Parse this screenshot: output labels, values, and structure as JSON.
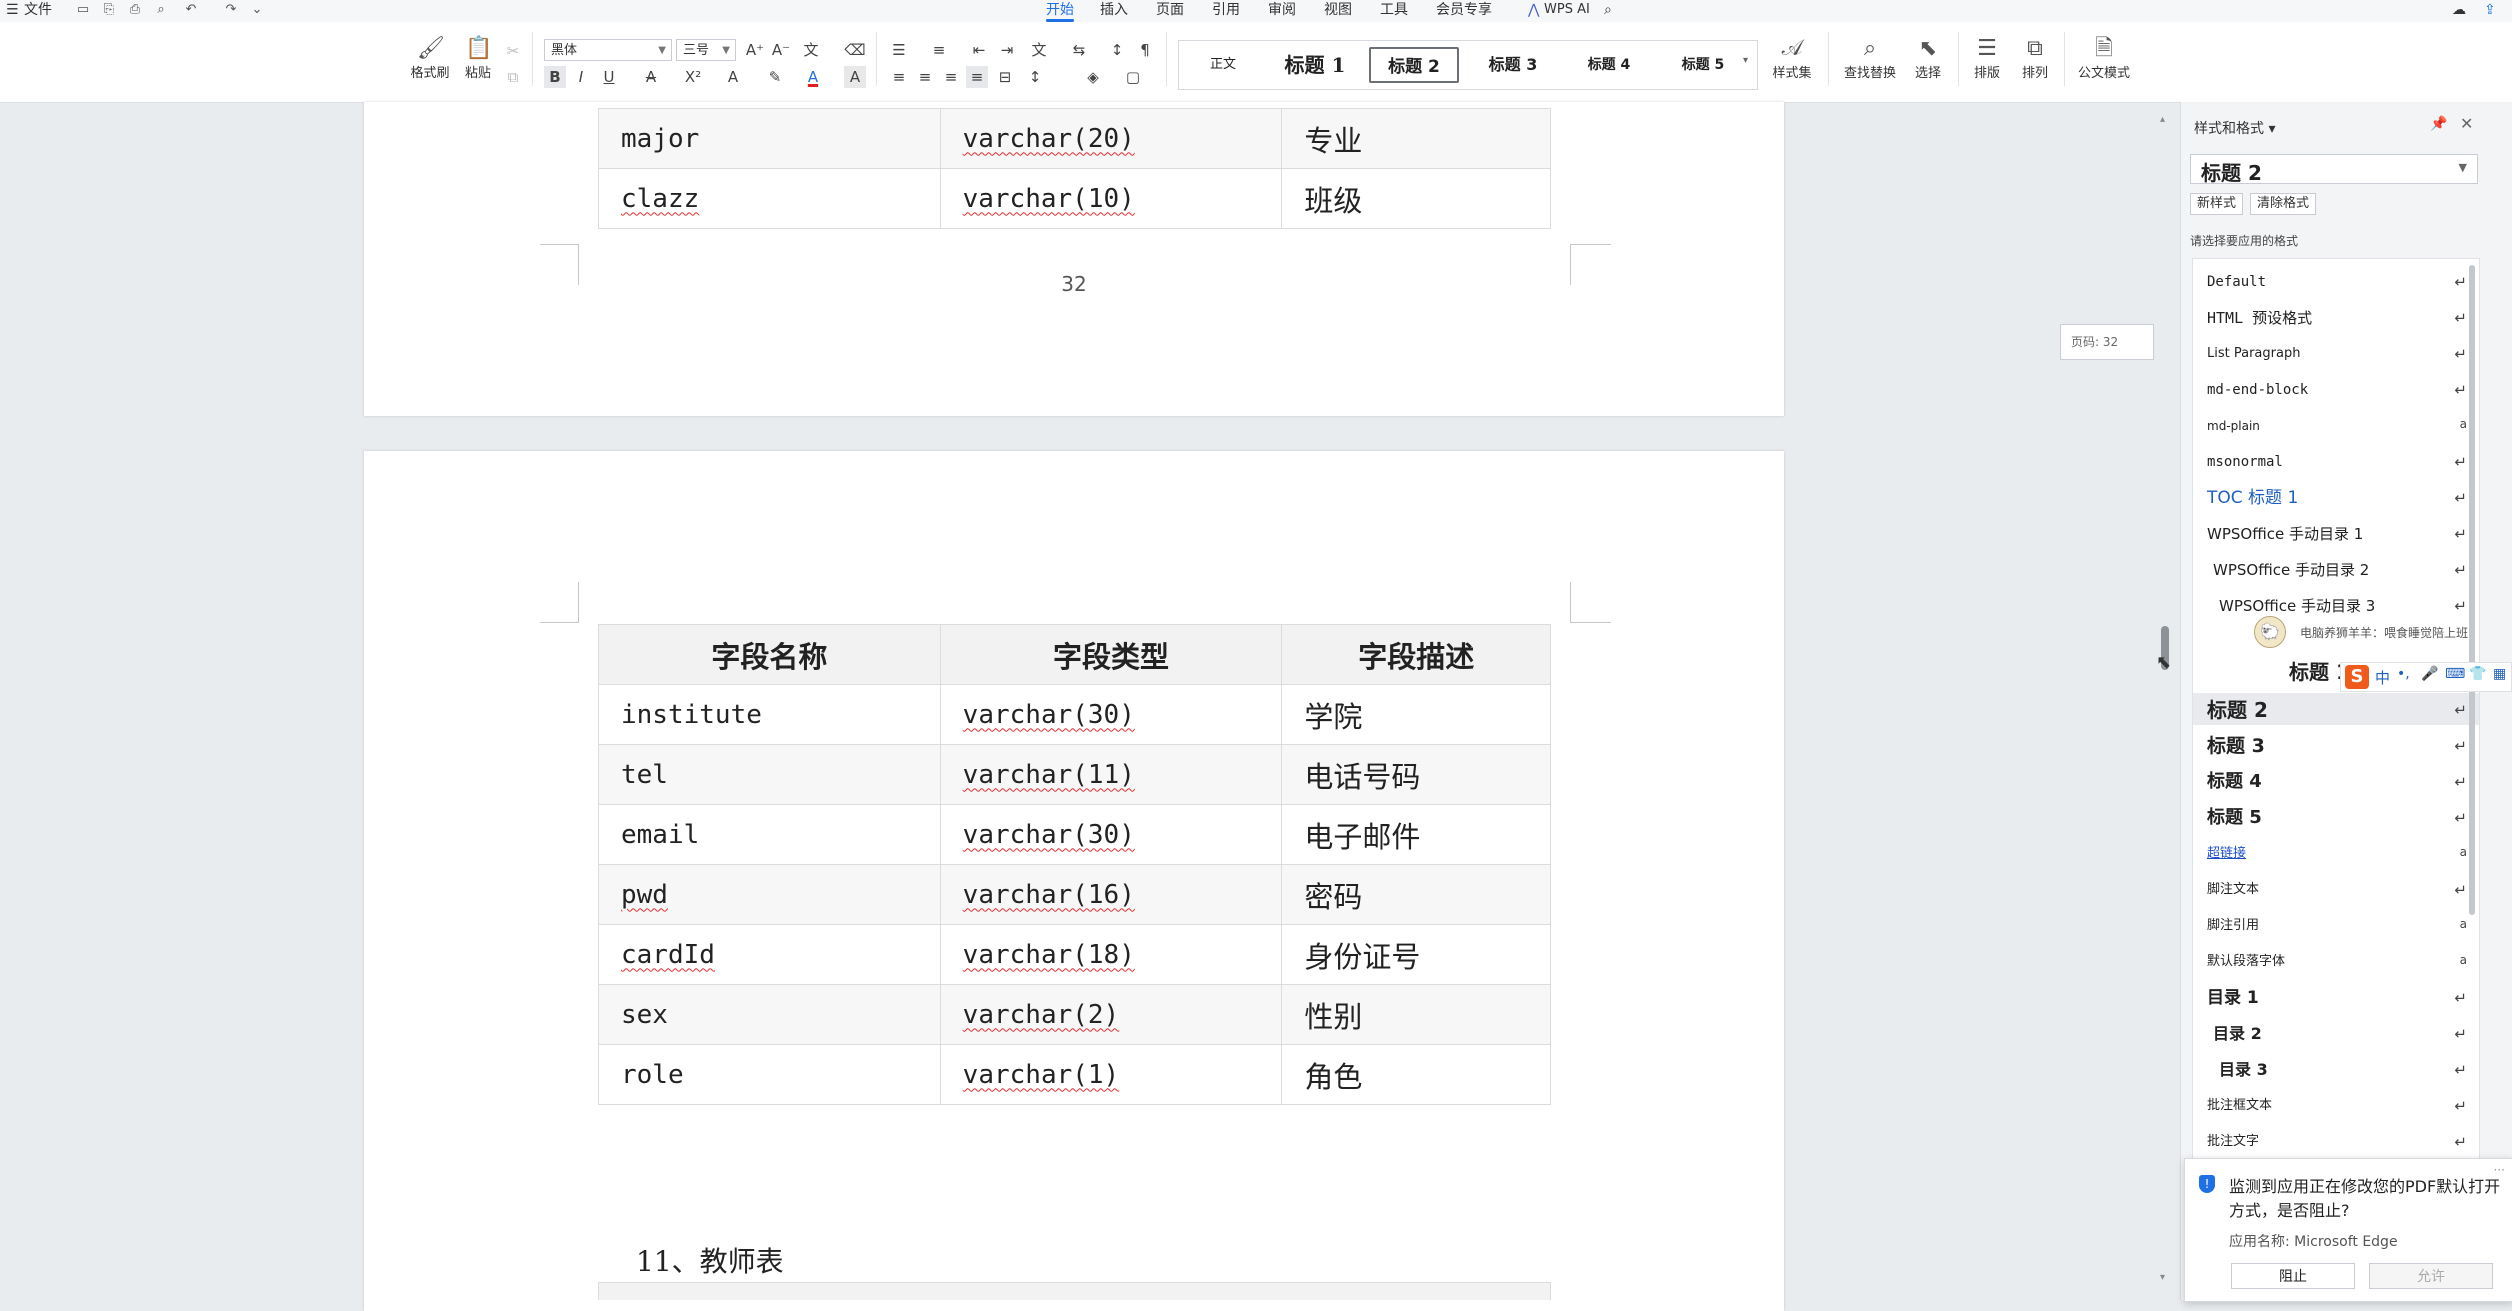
{
  "menubar": {
    "file_label": "文件",
    "tabs": [
      "开始",
      "插入",
      "页面",
      "引用",
      "审阅",
      "视图",
      "工具",
      "会员专享"
    ],
    "active_tab": "开始",
    "wps_ai_label": "WPS AI"
  },
  "ribbon": {
    "format_painter": "格式刷",
    "paste": "粘贴",
    "font_name": "黑体",
    "font_size": "三号",
    "styles": [
      "正文",
      "标题 1",
      "标题 2",
      "标题 3",
      "标题 4",
      "标题 5"
    ],
    "selected_style": "标题 2",
    "style_set": "样式集",
    "find_replace": "查找替换",
    "select": "选择",
    "layout": "排版",
    "arrange": "排列",
    "official_doc_mode": "公文模式"
  },
  "document": {
    "page1_rows": [
      {
        "name": "major",
        "type": "varchar(20)",
        "desc": "专业"
      },
      {
        "name": "clazz",
        "type": "varchar(10)",
        "desc": "班级"
      }
    ],
    "page_number": "32",
    "table_header": [
      "字段名称",
      "字段类型",
      "字段描述"
    ],
    "table_rows": [
      {
        "name": "institute",
        "type": "varchar(30)",
        "desc": "学院"
      },
      {
        "name": "tel",
        "type": "varchar(11)",
        "desc": "电话号码"
      },
      {
        "name": "email",
        "type": "varchar(30)",
        "desc": "电子邮件"
      },
      {
        "name": "pwd",
        "type": "varchar(16)",
        "desc": "密码"
      },
      {
        "name": "cardId",
        "type": "varchar(18)",
        "desc": "身份证号"
      },
      {
        "name": "sex",
        "type": "varchar(2)",
        "desc": "性别"
      },
      {
        "name": "role",
        "type": "varchar(1)",
        "desc": "角色"
      }
    ],
    "section_heading": "11、教师表",
    "page_indicator": "页码: 32"
  },
  "styles_pane": {
    "title": "样式和格式",
    "current_style": "标题 2",
    "new_style_btn": "新样式",
    "clear_format_btn": "清除格式",
    "prompt": "请选择要应用的格式",
    "items": [
      {
        "label": "Default",
        "mark": "↵"
      },
      {
        "label": "HTML 预设格式",
        "mark": "↵"
      },
      {
        "label": "List Paragraph",
        "mark": "↵"
      },
      {
        "label": "md-end-block",
        "mark": "↵"
      },
      {
        "label": "md-plain",
        "mark": "a"
      },
      {
        "label": "msonormal",
        "mark": "↵"
      },
      {
        "label": "TOC 标题 1",
        "mark": "↵"
      },
      {
        "label": "WPSOffice 手动目录 1",
        "mark": "↵"
      },
      {
        "label": "WPSOffice 手动目录 2",
        "mark": "↵"
      },
      {
        "label": "WPSOffice 手动目录 3",
        "mark": "↵"
      },
      {
        "label": "标题 1",
        "mark": ""
      },
      {
        "label": "标题 2",
        "mark": "↵"
      },
      {
        "label": "标题 3",
        "mark": "↵"
      },
      {
        "label": "标题 4",
        "mark": "↵"
      },
      {
        "label": "标题 5",
        "mark": "↵"
      },
      {
        "label": "超链接",
        "mark": "a"
      },
      {
        "label": "脚注文本",
        "mark": "↵"
      },
      {
        "label": "脚注引用",
        "mark": "a"
      },
      {
        "label": "默认段落字体",
        "mark": "a"
      },
      {
        "label": "目录 1",
        "mark": "↵"
      },
      {
        "label": "目录 2",
        "mark": "↵"
      },
      {
        "label": "目录 3",
        "mark": "↵"
      },
      {
        "label": "批注框文本",
        "mark": "↵"
      },
      {
        "label": "批注文字",
        "mark": "↵"
      }
    ],
    "ime_tooltip": "电脑养狮羊羊：喂食睡觉陪上班",
    "ime_chars": "中"
  },
  "notification": {
    "title": "监测到应用正在修改您的PDF默认打开方式，是否阻止?",
    "app_line": "应用名称: Microsoft Edge",
    "block_btn": "阻止",
    "allow_btn": "允许"
  },
  "colors": {
    "accent": "#1f6fe5",
    "squiggle": "#e03030",
    "ime_orange": "#f05a1a"
  }
}
